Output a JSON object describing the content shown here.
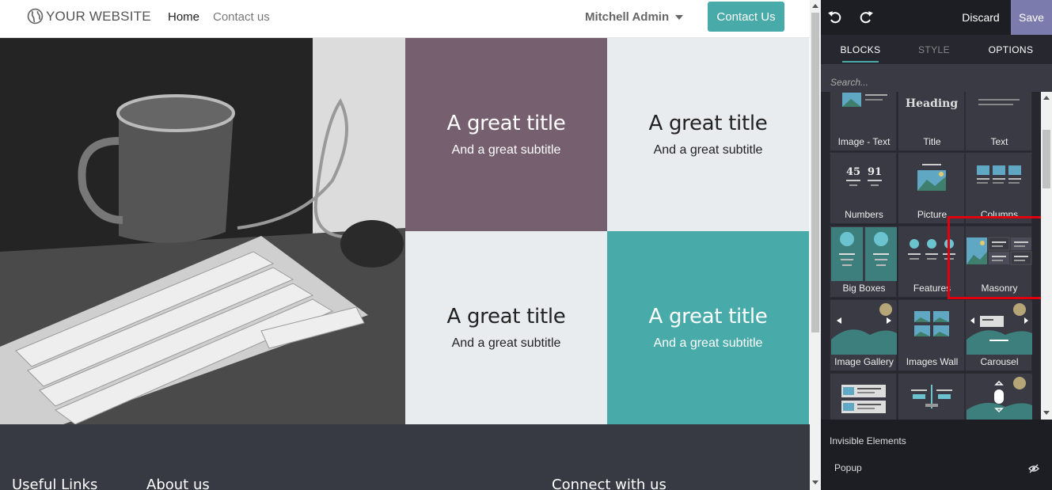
{
  "navbar": {
    "brand": "YOUR WEBSITE",
    "links": [
      "Home",
      "Contact us"
    ],
    "user": "Mitchell Admin",
    "cta": "Contact Us"
  },
  "tiles": [
    {
      "title": "A great title",
      "subtitle": "And a great subtitle"
    },
    {
      "title": "A great title",
      "subtitle": "And a great subtitle"
    },
    {
      "title": "A great title",
      "subtitle": "And a great subtitle"
    },
    {
      "title": "A great title",
      "subtitle": "And a great subtitle"
    }
  ],
  "footer": {
    "headings": [
      "Useful Links",
      "About us",
      "Connect with us"
    ]
  },
  "editor": {
    "discard": "Discard",
    "save": "Save",
    "tabs": [
      "BLOCKS",
      "STYLE",
      "OPTIONS"
    ],
    "search_placeholder": "Search...",
    "heading_thumb": "Heading",
    "number_thumb": [
      "45",
      "91"
    ],
    "blocks": [
      {
        "label": "Image - Text"
      },
      {
        "label": "Title"
      },
      {
        "label": "Text"
      },
      {
        "label": "Numbers"
      },
      {
        "label": "Picture"
      },
      {
        "label": "Columns"
      },
      {
        "label": "Big Boxes"
      },
      {
        "label": "Features"
      },
      {
        "label": "Masonry"
      },
      {
        "label": "Image Gallery"
      },
      {
        "label": "Images Wall"
      },
      {
        "label": "Carousel"
      },
      {
        "label": ""
      },
      {
        "label": ""
      },
      {
        "label": ""
      }
    ],
    "invisible_title": "Invisible Elements",
    "invisible_items": [
      "Popup"
    ]
  },
  "colors": {
    "teal": "#48abaa",
    "mauve": "#765f6f",
    "light": "#e9ecef",
    "panel": "#272730",
    "save": "#7c7bad",
    "highlight": "#e0000d"
  }
}
